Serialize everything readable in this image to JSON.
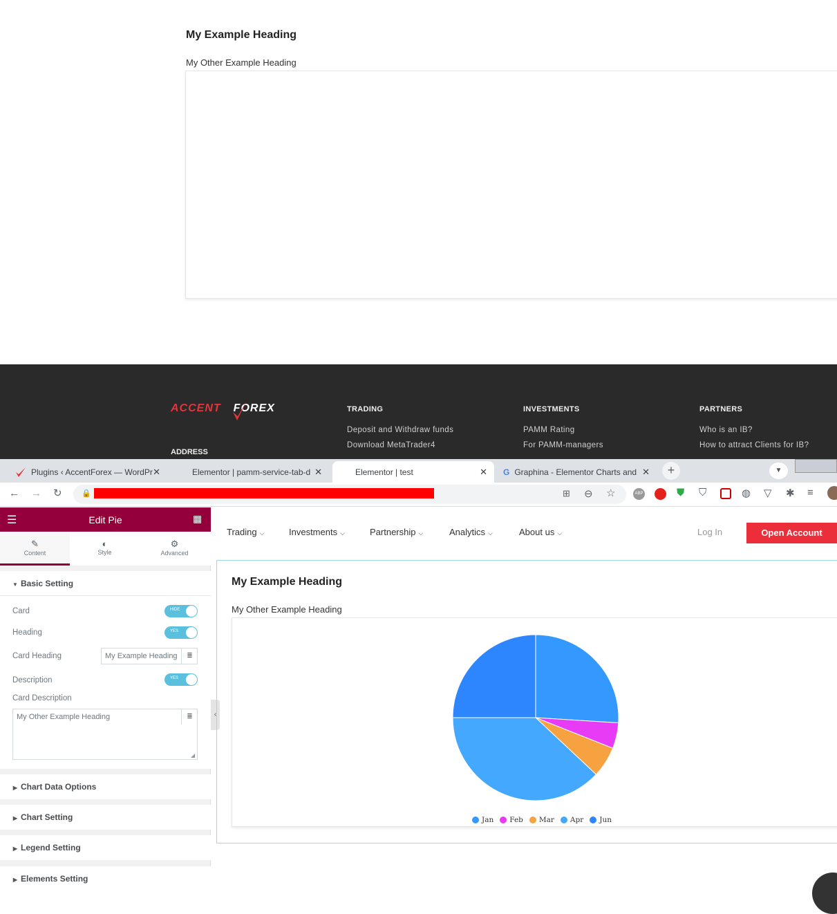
{
  "top_card": {
    "heading": "My Example Heading",
    "description": "My Other Example Heading"
  },
  "footer": {
    "logo_part1": "ACCENT",
    "logo_part2": "FOREX",
    "address_title": "ADDRESS",
    "columns": [
      {
        "title": "TRADING",
        "links": [
          "Deposit and Withdraw funds",
          "Download MetaTrader4"
        ]
      },
      {
        "title": "INVESTMENTS",
        "links": [
          "PAMM Rating",
          "For PAMM-managers"
        ]
      },
      {
        "title": "PARTNERS",
        "links": [
          "Who is an IB?",
          "How to attract Clients for IB?"
        ]
      }
    ]
  },
  "browser": {
    "tabs": [
      {
        "label": "Plugins ‹ AccentForex — WordPr",
        "active": false
      },
      {
        "label": "Elementor | pamm-service-tab-d",
        "active": false
      },
      {
        "label": "Elementor | test",
        "active": true
      },
      {
        "label": "Graphina - Elementor Charts and",
        "active": false
      }
    ],
    "new_tab": "+"
  },
  "editor": {
    "title": "Edit Pie",
    "tabs": [
      "Content",
      "Style",
      "Advanced"
    ],
    "basic_setting": "Basic Setting",
    "card_label": "Card",
    "card_toggle": "HIDE",
    "heading_label": "Heading",
    "heading_toggle": "YES",
    "card_heading_label": "Card Heading",
    "card_heading_value": "My Example Heading",
    "description_label": "Description",
    "description_toggle": "YES",
    "card_description_label": "Card Description",
    "card_description_value": "My Other Example Heading",
    "sections": [
      "Chart Data Options",
      "Chart Setting",
      "Legend Setting",
      "Elements Setting"
    ]
  },
  "site_nav": {
    "items": [
      "Trading",
      "Investments",
      "Partnership",
      "Analytics",
      "About us"
    ],
    "login": "Log In",
    "cta": "Open Account"
  },
  "card": {
    "heading": "My Example Heading",
    "description": "My Other Example Heading"
  },
  "chart_data": {
    "type": "pie",
    "categories": [
      "Jan",
      "Feb",
      "Mar",
      "Apr",
      "Jun"
    ],
    "values": [
      26,
      5,
      6,
      38,
      25
    ],
    "colors": [
      "#3399ff",
      "#e83bf5",
      "#f7a240",
      "#45a8ff",
      "#2e86ff"
    ]
  }
}
